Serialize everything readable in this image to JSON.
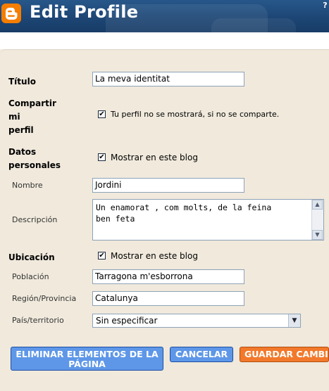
{
  "header": {
    "title": "Edit Profile",
    "help_icon": "?",
    "logo": "blogger-logo",
    "colors": {
      "bar": "#1d4675",
      "logo": "#f57d00"
    }
  },
  "form": {
    "titulo": {
      "label": "Título",
      "value": "La meva identitat"
    },
    "compartir": {
      "label_lines": [
        "Compartir",
        "mi",
        "perfil"
      ],
      "checked": true,
      "text": "Tu perfil no se mostrará, si no se comparte."
    },
    "datos": {
      "label_lines": [
        "Datos",
        "personales"
      ],
      "checked": true,
      "text": "Mostrar en este blog"
    },
    "nombre": {
      "label": "Nombre",
      "value": "Jordini"
    },
    "descripcion": {
      "label": "Descripción",
      "lines": [
        "Un enamorat , com molts, de la feina",
        "ben feta"
      ]
    },
    "ubicacion": {
      "label": "Ubicación",
      "checked": true,
      "text": "Mostrar en este blog"
    },
    "poblacion": {
      "label": "Población",
      "value": "Tarragona m'esborrona"
    },
    "region": {
      "label": "Región/Provincia",
      "value": "Catalunya"
    },
    "pais": {
      "label": "País/territorio",
      "selected": "Sin especificar"
    }
  },
  "buttons": {
    "delete_lines": [
      "ELIMINAR ELEMENTOS DE LA",
      "PÁGINA"
    ],
    "cancel": "CANCELAR",
    "save": "GUARDAR CAMBIOS"
  }
}
